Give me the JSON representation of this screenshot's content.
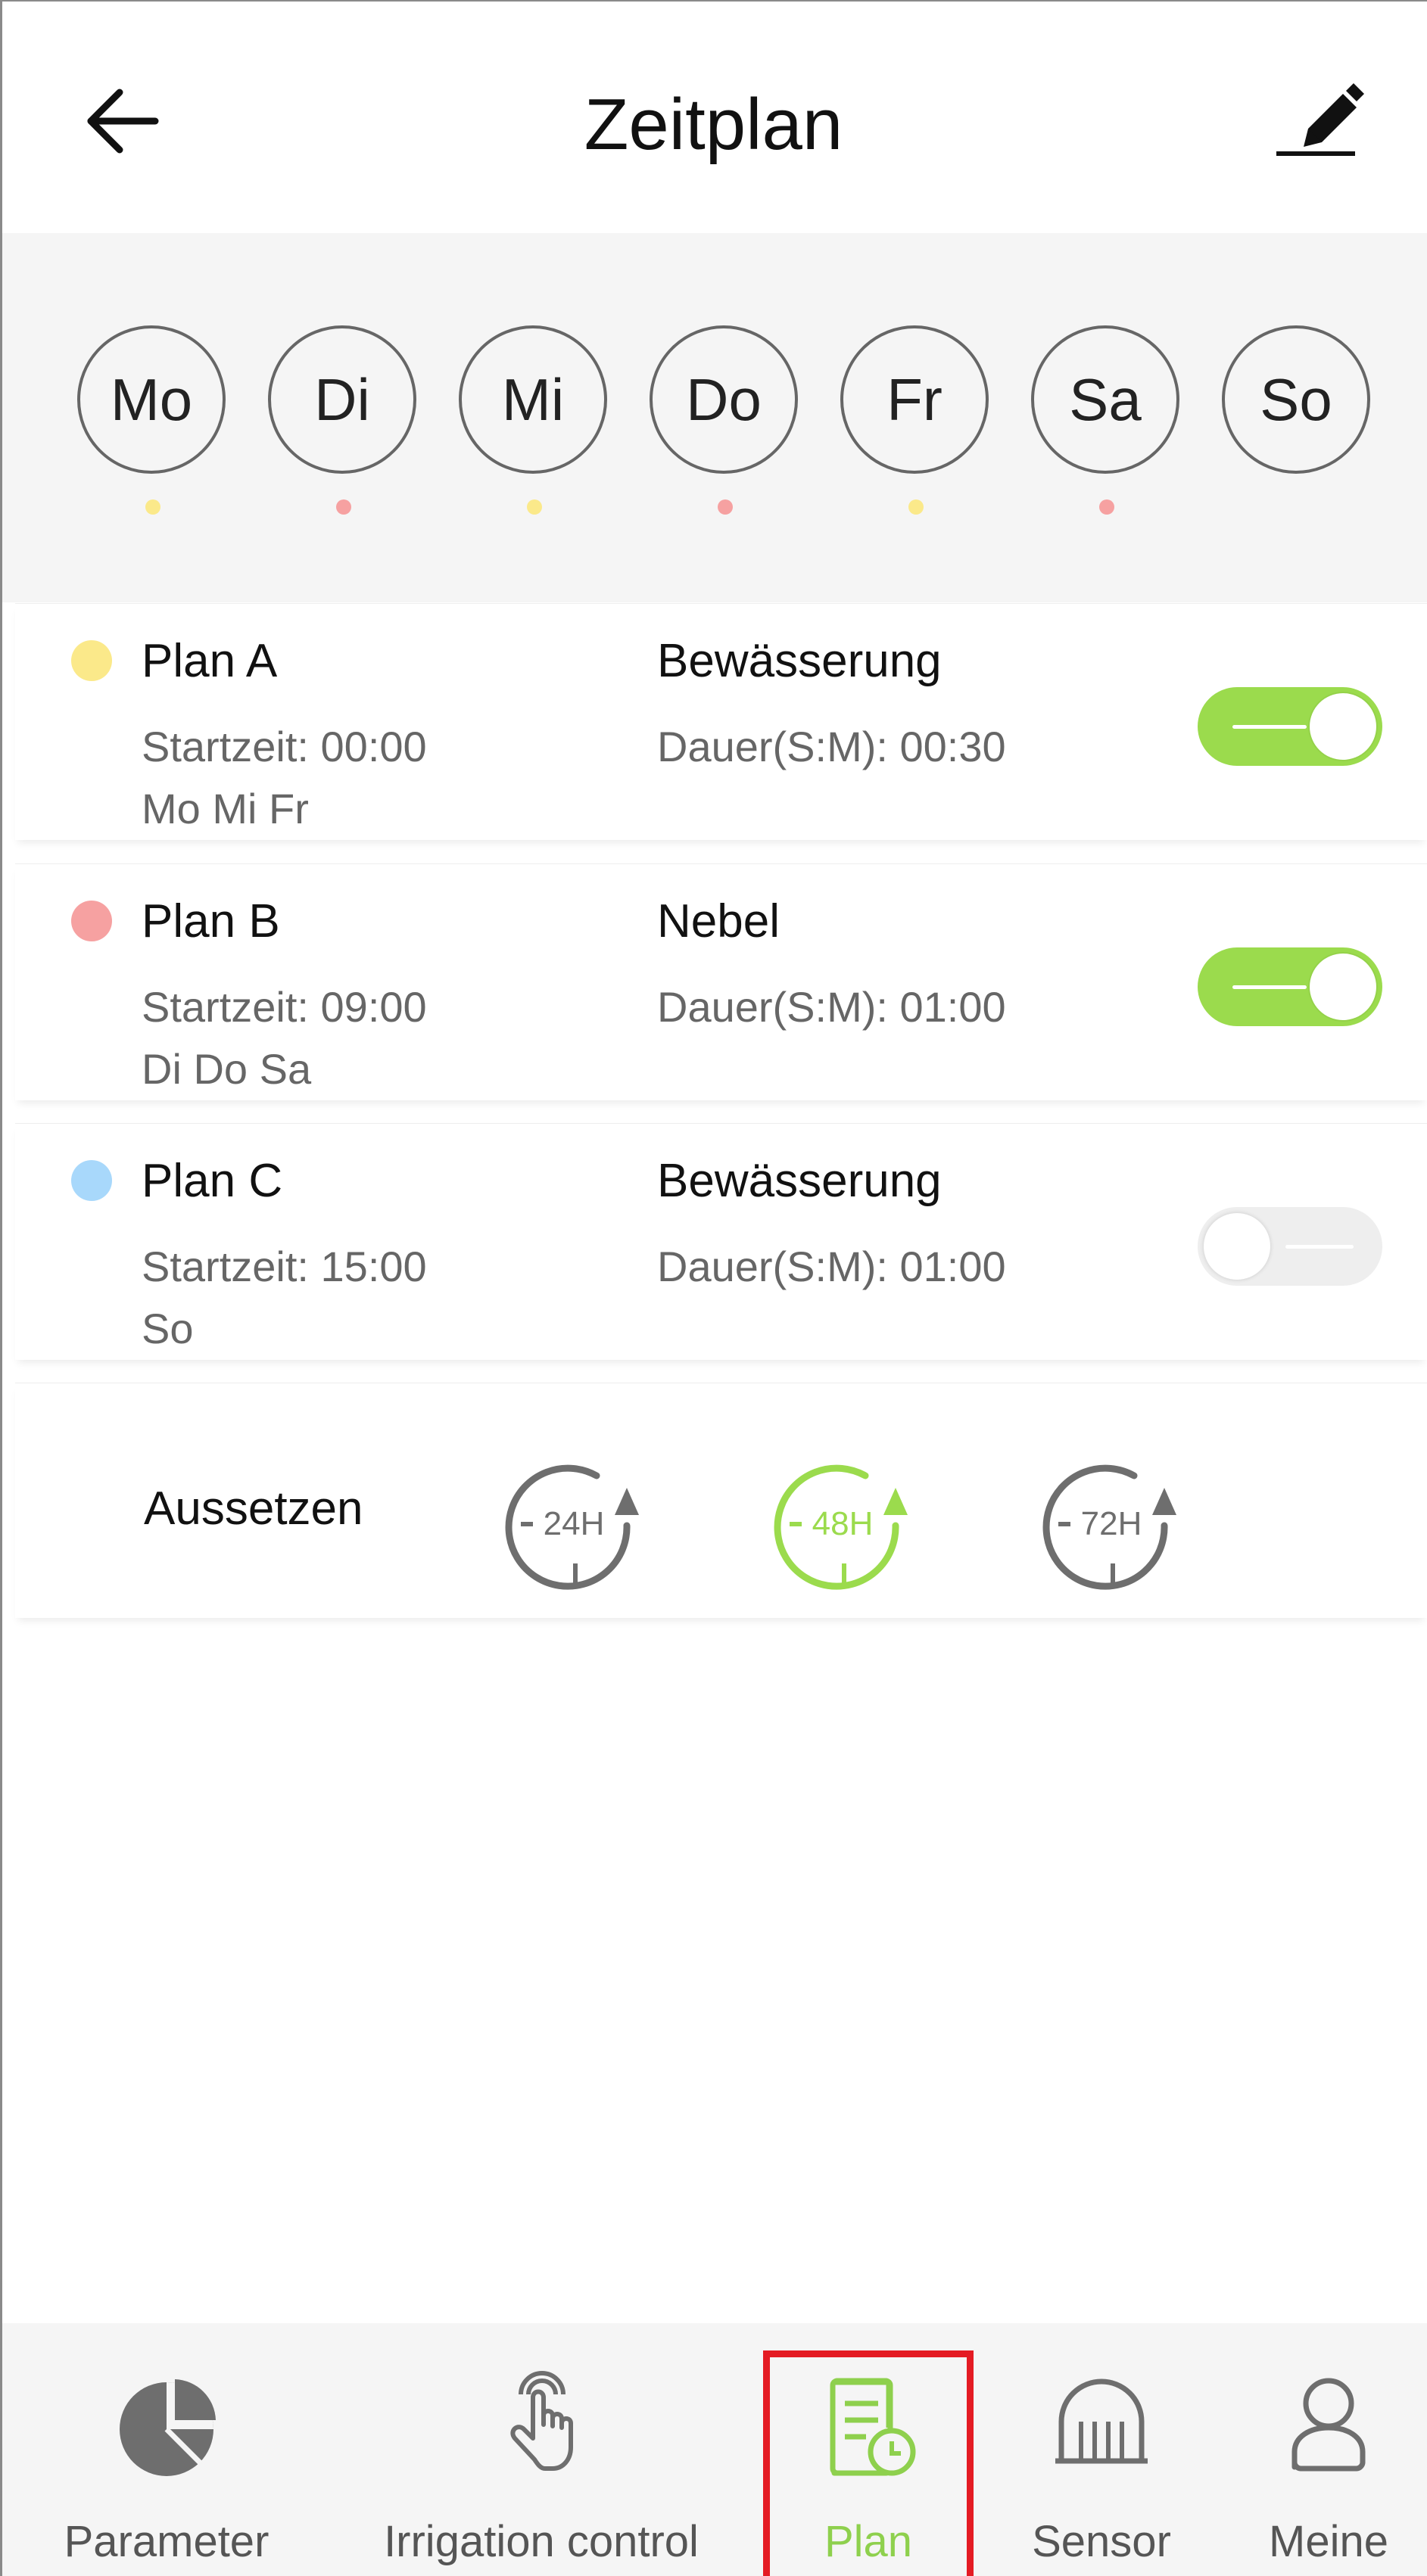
{
  "header": {
    "title": "Zeitplan",
    "back_icon": "arrow-left-icon",
    "edit_icon": "pencil-icon"
  },
  "days": [
    {
      "label": "Mo",
      "dot_color": "#fbe98a"
    },
    {
      "label": "Di",
      "dot_color": "#f6a1a1"
    },
    {
      "label": "Mi",
      "dot_color": "#fbe98a"
    },
    {
      "label": "Do",
      "dot_color": "#f6a1a1"
    },
    {
      "label": "Fr",
      "dot_color": "#fbe98a"
    },
    {
      "label": "Sa",
      "dot_color": "#f6a1a1"
    },
    {
      "label": "So",
      "dot_color": null
    }
  ],
  "plans": [
    {
      "name": "Plan A",
      "color": "#fbe98a",
      "start": "Startzeit: 00:00",
      "days": "Mo Mi Fr",
      "mode": "Bewässerung",
      "duration": "Dauer(S:M): 00:30",
      "enabled": true
    },
    {
      "name": "Plan B",
      "color": "#f6a1a1",
      "start": "Startzeit: 09:00",
      "days": "Di Do Sa",
      "mode": "Nebel",
      "duration": "Dauer(S:M): 01:00",
      "enabled": true
    },
    {
      "name": "Plan C",
      "color": "#a8d8fb",
      "start": "Startzeit: 15:00",
      "days": "So",
      "mode": "Bewässerung",
      "duration": "Dauer(S:M): 01:00",
      "enabled": false
    }
  ],
  "pause": {
    "label": "Aussetzen",
    "options": [
      {
        "label": "24H",
        "selected": false
      },
      {
        "label": "48H",
        "selected": true
      },
      {
        "label": "72H",
        "selected": false
      }
    ]
  },
  "nav": {
    "items": [
      {
        "label": "Parameter",
        "icon": "pie-chart-icon",
        "active": false
      },
      {
        "label": "Irrigation control",
        "icon": "hand-pointer-icon",
        "active": false
      },
      {
        "label": "Plan",
        "icon": "schedule-document-icon",
        "active": true
      },
      {
        "label": "Sensor",
        "icon": "sensor-icon",
        "active": false
      },
      {
        "label": "Meine",
        "icon": "user-icon",
        "active": false
      }
    ]
  },
  "colors": {
    "accent_green": "#9bdb4d",
    "active_nav_green": "#8ed04d",
    "highlight_red": "#e41b23",
    "inactive_gray": "#666666"
  }
}
